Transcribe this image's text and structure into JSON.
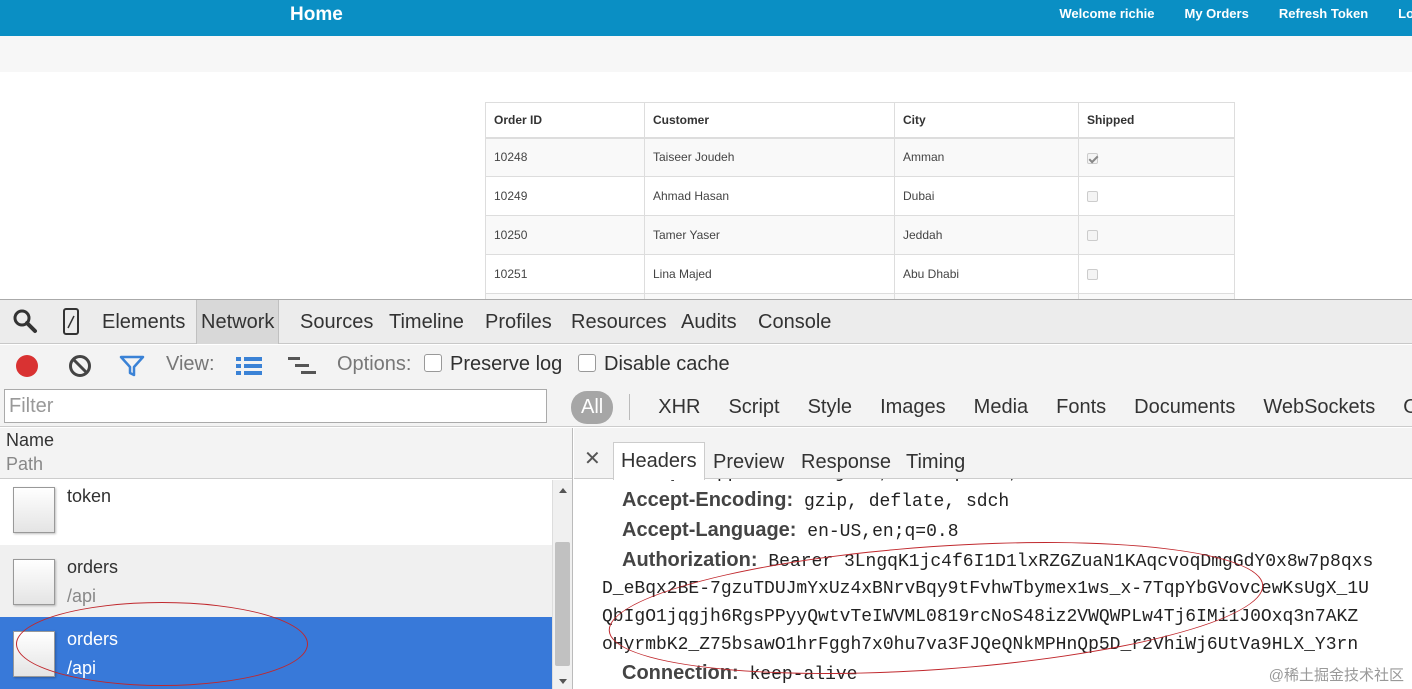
{
  "navbar": {
    "brand": "Home",
    "links": [
      "Welcome richie",
      "My Orders",
      "Refresh Token",
      "Log"
    ]
  },
  "orders_table": {
    "headers": [
      "Order ID",
      "Customer",
      "City",
      "Shipped"
    ],
    "rows": [
      {
        "id": "10248",
        "customer": "Taiseer Joudeh",
        "city": "Amman",
        "shipped": true
      },
      {
        "id": "10249",
        "customer": "Ahmad Hasan",
        "city": "Dubai",
        "shipped": false
      },
      {
        "id": "10250",
        "customer": "Tamer Yaser",
        "city": "Jeddah",
        "shipped": false
      },
      {
        "id": "10251",
        "customer": "Lina Majed",
        "city": "Abu Dhabi",
        "shipped": false
      }
    ]
  },
  "devtools": {
    "tabs": [
      "Elements",
      "Network",
      "Sources",
      "Timeline",
      "Profiles",
      "Resources",
      "Audits",
      "Console"
    ],
    "active_tab": "Network",
    "toolbar": {
      "view_label": "View:",
      "options_label": "Options:",
      "preserve_log": "Preserve log",
      "disable_cache": "Disable cache"
    },
    "filter_placeholder": "Filter",
    "type_filters": [
      "All",
      "XHR",
      "Script",
      "Style",
      "Images",
      "Media",
      "Fonts",
      "Documents",
      "WebSockets",
      "O"
    ],
    "list_header": {
      "name": "Name",
      "path": "Path"
    },
    "requests": [
      {
        "name": "token",
        "path": ""
      },
      {
        "name": "orders",
        "path": "/api"
      },
      {
        "name": "orders",
        "path": "/api"
      }
    ],
    "detail_tabs": [
      "Headers",
      "Preview",
      "Response",
      "Timing"
    ],
    "headers": [
      {
        "key": "Accept:",
        "value": "application/json, text/plain, */*"
      },
      {
        "key": "Accept-Encoding:",
        "value": "gzip, deflate, sdch"
      },
      {
        "key": "Accept-Language:",
        "value": "en-US,en;q=0.8"
      },
      {
        "key": "Authorization:",
        "value": "Bearer 3LngqK1jc4f6I1D1lxRZGZuaN1KAqcvoqDmgGdY0x8w7p8qxs"
      }
    ],
    "auth_continuation": [
      "D_eBqx2BE-7gzuTDUJmYxUz4xBNrvBqy9tFvhwTbymex1ws_x-7TqpYbGVovcewKsUgX_1U",
      "QbIgO1jqgjh6RgsPPyyQwtvTeIWVML0819rcNoS48iz2VWQWPLw4Tj6IMi1J0Oxq3n7AKZ",
      "oHyrmbK2_Z75bsawO1hrFggh7x0hu7va3FJQeQNkMPHnQp5D_r2VhiWj6UtVa9HLX_Y3rn"
    ],
    "last_header": {
      "key": "Connection:",
      "value": "keep-alive"
    }
  },
  "watermark": "@稀土掘金技术社区",
  "colors": {
    "navbar": "#0a8fc4",
    "selected_row": "#3879d9",
    "record": "#d93232",
    "annotation": "#c0282d"
  }
}
